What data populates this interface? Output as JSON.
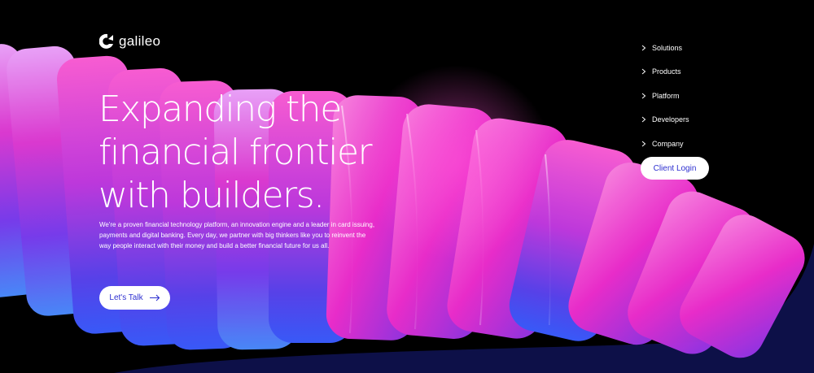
{
  "brand": {
    "name": "galileo",
    "logo_icon": "galileo-g-icon"
  },
  "nav": {
    "items": [
      {
        "label": "Solutions",
        "icon": "chevron-right-icon"
      },
      {
        "label": "Products",
        "icon": "chevron-right-icon"
      },
      {
        "label": "Platform",
        "icon": "chevron-right-icon"
      },
      {
        "label": "Developers",
        "icon": "chevron-right-icon"
      },
      {
        "label": "Company",
        "icon": "chevron-right-icon"
      }
    ],
    "login_label": "Client Login"
  },
  "hero": {
    "title_lines": [
      "Expanding the",
      "financial frontier",
      "with builders."
    ],
    "body": "We're a proven financial technology platform, an innovation engine and a leader in card issuing, payments and digital banking. Every day, we partner with big thinkers like you to reinvent the way people interact with their money and build a better financial future for us all.",
    "cta_label": "Let's Talk",
    "cta_icon": "arrow-right-icon"
  },
  "colors": {
    "background": "#000000",
    "accent_blue": "#2d2fd0",
    "magenta": "#ff2bd0",
    "violet": "#7a3cff",
    "navy_wave": "#0d1048"
  }
}
